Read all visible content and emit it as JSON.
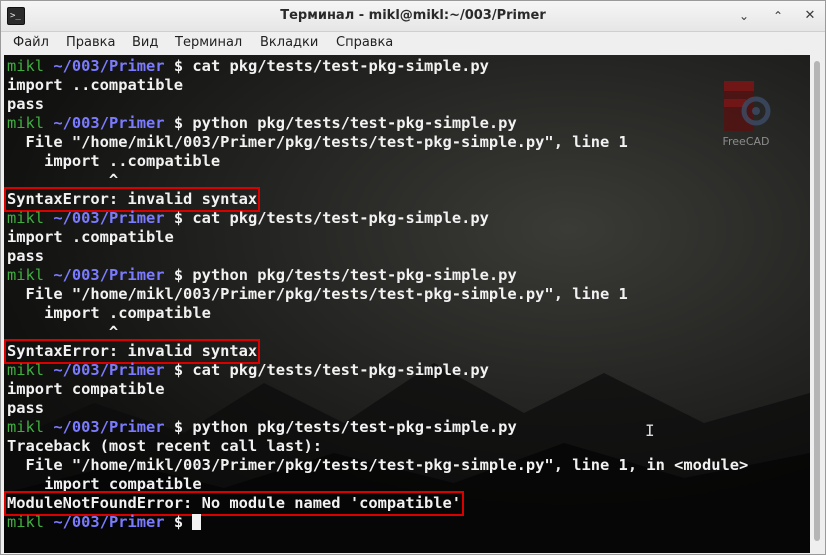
{
  "window": {
    "title": "Терминал - mikl@mikl:~/003/Primer",
    "icon": "terminal-icon",
    "controls": {
      "minimize": "minimize-icon",
      "maximize": "maximize-icon",
      "close": "close-icon"
    }
  },
  "menu": {
    "items": [
      "Файл",
      "Правка",
      "Вид",
      "Терминал",
      "Вкладки",
      "Справка"
    ]
  },
  "prompt": {
    "user": "mikl",
    "path": "~/003/Primer",
    "symbol": "$"
  },
  "desktop": {
    "freecad_label": "FreeCAD"
  },
  "colors": {
    "user": "#3fae3f",
    "path": "#7b7bff",
    "highlight": "#d90000",
    "text": "#f2f2f2"
  },
  "lines": [
    {
      "kind": "prompt",
      "cmd": "cat pkg/tests/test-pkg-simple.py"
    },
    {
      "kind": "text",
      "text": "import ..compatible"
    },
    {
      "kind": "text",
      "text": "pass"
    },
    {
      "kind": "prompt",
      "cmd": "python pkg/tests/test-pkg-simple.py"
    },
    {
      "kind": "text",
      "text": "  File \"/home/mikl/003/Primer/pkg/tests/test-pkg-simple.py\", line 1"
    },
    {
      "kind": "text",
      "text": "    import ..compatible"
    },
    {
      "kind": "text",
      "text": "           ^"
    },
    {
      "kind": "error",
      "text": "SyntaxError: invalid syntax"
    },
    {
      "kind": "prompt",
      "cmd": "cat pkg/tests/test-pkg-simple.py"
    },
    {
      "kind": "text",
      "text": "import .compatible"
    },
    {
      "kind": "text",
      "text": "pass"
    },
    {
      "kind": "prompt",
      "cmd": "python pkg/tests/test-pkg-simple.py"
    },
    {
      "kind": "text",
      "text": "  File \"/home/mikl/003/Primer/pkg/tests/test-pkg-simple.py\", line 1"
    },
    {
      "kind": "text",
      "text": "    import .compatible"
    },
    {
      "kind": "text",
      "text": "           ^"
    },
    {
      "kind": "error",
      "text": "SyntaxError: invalid syntax"
    },
    {
      "kind": "prompt",
      "cmd": "cat pkg/tests/test-pkg-simple.py"
    },
    {
      "kind": "text",
      "text": "import compatible"
    },
    {
      "kind": "text",
      "text": "pass"
    },
    {
      "kind": "prompt",
      "cmd": "python pkg/tests/test-pkg-simple.py"
    },
    {
      "kind": "text",
      "text": "Traceback (most recent call last):"
    },
    {
      "kind": "text",
      "text": "  File \"/home/mikl/003/Primer/pkg/tests/test-pkg-simple.py\", line 1, in <module>"
    },
    {
      "kind": "text",
      "text": "    import compatible"
    },
    {
      "kind": "error",
      "text": "ModuleNotFoundError: No module named 'compatible'"
    },
    {
      "kind": "prompt",
      "cmd": "",
      "cursor": true
    }
  ]
}
